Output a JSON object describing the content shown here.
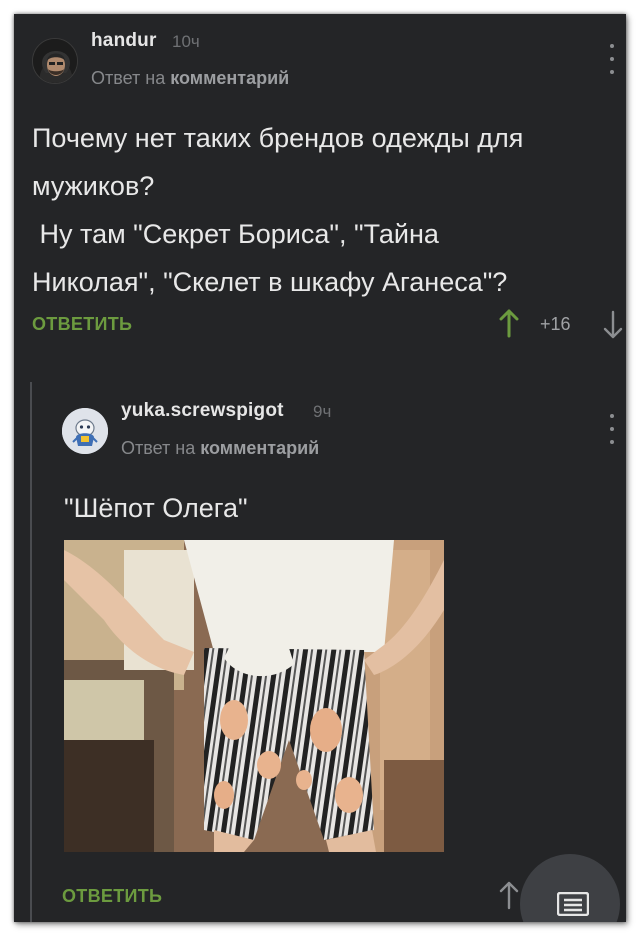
{
  "comments": [
    {
      "author": "handur",
      "time": "10ч",
      "reply_prefix": "Ответ на",
      "reply_link": "комментарий",
      "text_lines": [
        "Почему нет таких брендов одежды для",
        "мужиков?",
        " Ну там \"Секрет Бориса\", \"Тайна",
        "Николая\", \"Скелет в шкафу Аганеса\"?"
      ],
      "reply_label": "ОТВЕТИТЬ",
      "rating": "+16"
    },
    {
      "author": "yuka.screwspigot",
      "time": "9ч",
      "reply_prefix": "Ответ на",
      "reply_link": "комментарий",
      "text": "\"Шёпот Олега\"",
      "reply_label": "ОТВЕТИТЬ"
    }
  ],
  "colors": {
    "background": "#242527",
    "accent_green": "#6c9b3f",
    "text": "#e8e8e8",
    "muted": "#86888b"
  },
  "icons": [
    "more-vertical-icon",
    "arrow-up-icon",
    "arrow-down-icon",
    "comments-icon"
  ]
}
